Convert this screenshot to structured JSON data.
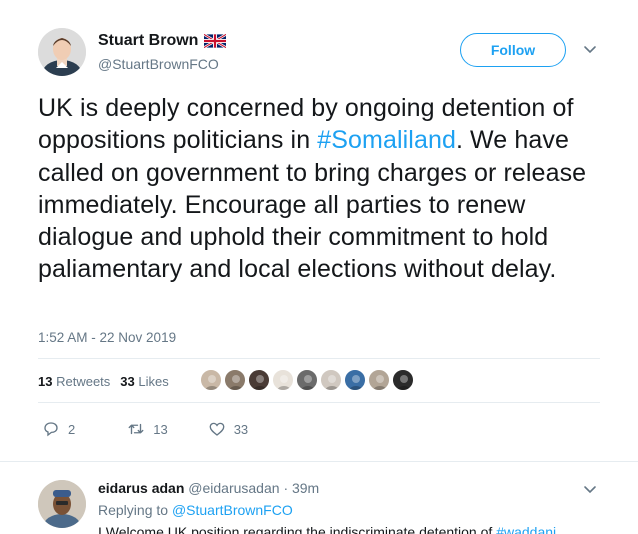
{
  "author": {
    "name": "Stuart Brown",
    "handle": "@StuartBrownFCO",
    "flag_icon": "uk-flag-icon"
  },
  "follow_label": "Follow",
  "tweet": {
    "text_before": "UK is deeply concerned by ongoing detention of oppositions politicians in ",
    "hashtag": "#Somaliland",
    "text_after": ". We have called on government to bring charges or release immediately. Encourage all parties to renew dialogue and uphold their commitment to hold paliamentary and local elections without delay.",
    "timestamp": "1:52 AM - 22 Nov 2019"
  },
  "stats": {
    "retweets_count": "13",
    "retweets_label": "Retweets",
    "likes_count": "33",
    "likes_label": "Likes"
  },
  "likers": [
    {
      "color": "#c9b8a6"
    },
    {
      "color": "#8a7a6a"
    },
    {
      "color": "#4a3b35"
    },
    {
      "color": "#e8e2da"
    },
    {
      "color": "#6b6b6b"
    },
    {
      "color": "#d0c8c0"
    },
    {
      "color": "#3a6ea5"
    },
    {
      "color": "#b2a596"
    },
    {
      "color": "#2b2b2b"
    }
  ],
  "actions": {
    "reply_count": "2",
    "retweet_count": "13",
    "like_count": "33"
  },
  "reply": {
    "name": "eidarus adan",
    "handle": "@eidarusadan",
    "time": "· 39m",
    "replying_prefix": "Replying to ",
    "replying_to": "@StuartBrownFCO",
    "body_text": "I Welcome UK position regarding the indiscriminate detention of ",
    "body_hashtag": "#waddani"
  },
  "colors": {
    "accent": "#1da1f2",
    "muted": "#657786",
    "text": "#14171a"
  }
}
